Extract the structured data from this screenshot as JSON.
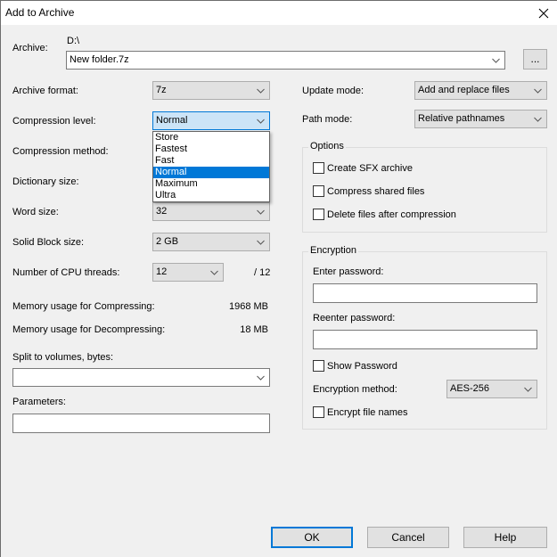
{
  "window": {
    "title": "Add to Archive",
    "close_icon": "close-icon"
  },
  "archive": {
    "label": "Archive:",
    "path": "D:\\",
    "filename": "New folder.7z",
    "browse_label": "..."
  },
  "left": {
    "archive_format": {
      "label": "Archive format:",
      "value": "7z"
    },
    "compression_level": {
      "label": "Compression level:",
      "value": "Normal",
      "options": [
        "Store",
        "Fastest",
        "Fast",
        "Normal",
        "Maximum",
        "Ultra"
      ],
      "selected_index": 3
    },
    "compression_method": {
      "label": "Compression method:"
    },
    "dictionary_size": {
      "label": "Dictionary size:"
    },
    "word_size": {
      "label": "Word size:",
      "value": "32"
    },
    "solid_block_size": {
      "label": "Solid Block size:",
      "value": "2 GB"
    },
    "cpu_threads": {
      "label": "Number of CPU threads:",
      "value": "12",
      "max": "/ 12"
    },
    "memory_compress": {
      "label": "Memory usage for Compressing:",
      "value": "1968 MB"
    },
    "memory_decompress": {
      "label": "Memory usage for Decompressing:",
      "value": "18 MB"
    },
    "split_volumes": {
      "label": "Split to volumes, bytes:",
      "value": ""
    },
    "parameters": {
      "label": "Parameters:",
      "value": ""
    }
  },
  "right": {
    "update_mode": {
      "label": "Update mode:",
      "value": "Add and replace files"
    },
    "path_mode": {
      "label": "Path mode:",
      "value": "Relative pathnames"
    },
    "options": {
      "title": "Options",
      "checkboxes": [
        {
          "label": "Create SFX archive",
          "checked": false
        },
        {
          "label": "Compress shared files",
          "checked": false
        },
        {
          "label": "Delete files after compression",
          "checked": false
        }
      ]
    },
    "encryption": {
      "title": "Encryption",
      "enter_password_label": "Enter password:",
      "enter_password_value": "",
      "reenter_password_label": "Reenter password:",
      "reenter_password_value": "",
      "show_password_label": "Show Password",
      "show_password_checked": false,
      "method_label": "Encryption method:",
      "method_value": "AES-256",
      "encrypt_names_label": "Encrypt file names",
      "encrypt_names_checked": false
    }
  },
  "buttons": {
    "ok": "OK",
    "cancel": "Cancel",
    "help": "Help"
  },
  "colors": {
    "accent": "#0078d7",
    "focus_fill": "#cce4f7",
    "dialog_bg": "#f0f0f0"
  }
}
